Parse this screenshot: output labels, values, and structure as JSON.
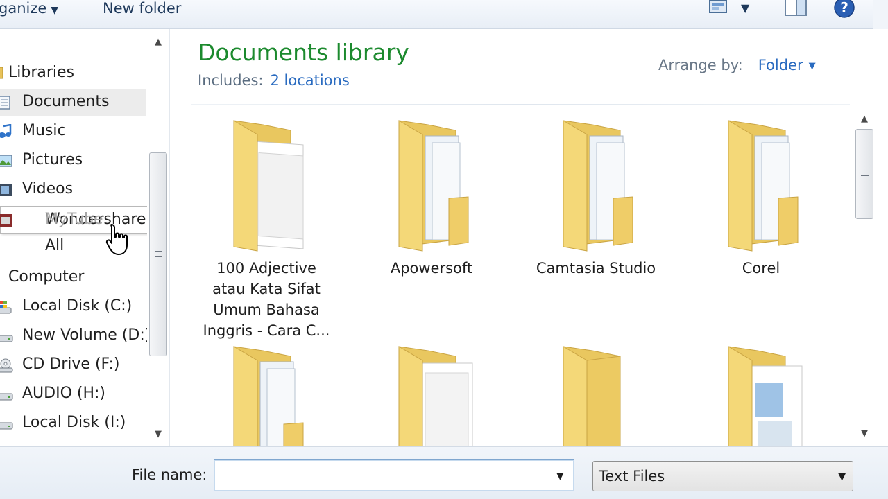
{
  "toolbar": {
    "organize_label": "ganize",
    "new_folder_label": "New folder"
  },
  "nav": {
    "libraries_label": "Libraries",
    "items": [
      {
        "label": "Documents",
        "icon": "documents-icon"
      },
      {
        "label": "Music",
        "icon": "music-icon"
      },
      {
        "label": "Pictures",
        "icon": "pictures-icon"
      },
      {
        "label": "Videos",
        "icon": "videos-icon"
      },
      {
        "label": "Wondershare All",
        "icon": "wondershare-icon"
      }
    ],
    "tooltip_visible": "Wondershare All",
    "tooltip_faded": "MyTube",
    "computer_label": "Computer",
    "drives": [
      {
        "label": "Local Disk (C:)",
        "icon": "system-drive-icon"
      },
      {
        "label": "New Volume (D:)",
        "icon": "hard-drive-icon"
      },
      {
        "label": "CD Drive (F:)",
        "icon": "cd-drive-icon"
      },
      {
        "label": "AUDIO (H:)",
        "icon": "hard-drive-icon"
      },
      {
        "label": "Local Disk (I:)",
        "icon": "hard-drive-icon"
      }
    ]
  },
  "content": {
    "title": "Documents library",
    "includes_label": "Includes:",
    "includes_link": "2 locations",
    "arrange_label": "Arrange by:",
    "arrange_value": "Folder",
    "folders": [
      {
        "name": "100 Adjective\natau Kata Sifat\nUmum Bahasa\nInggris - Cara C..."
      },
      {
        "name": "Apowersoft"
      },
      {
        "name": "Camtasia Studio"
      },
      {
        "name": "Corel"
      }
    ]
  },
  "footer": {
    "file_name_label": "File name:",
    "file_name_value": "",
    "file_type_value": "Text Files"
  },
  "colors": {
    "library_title": "#1c8a2e",
    "link": "#2a6bc0",
    "selection": "#ececec"
  }
}
